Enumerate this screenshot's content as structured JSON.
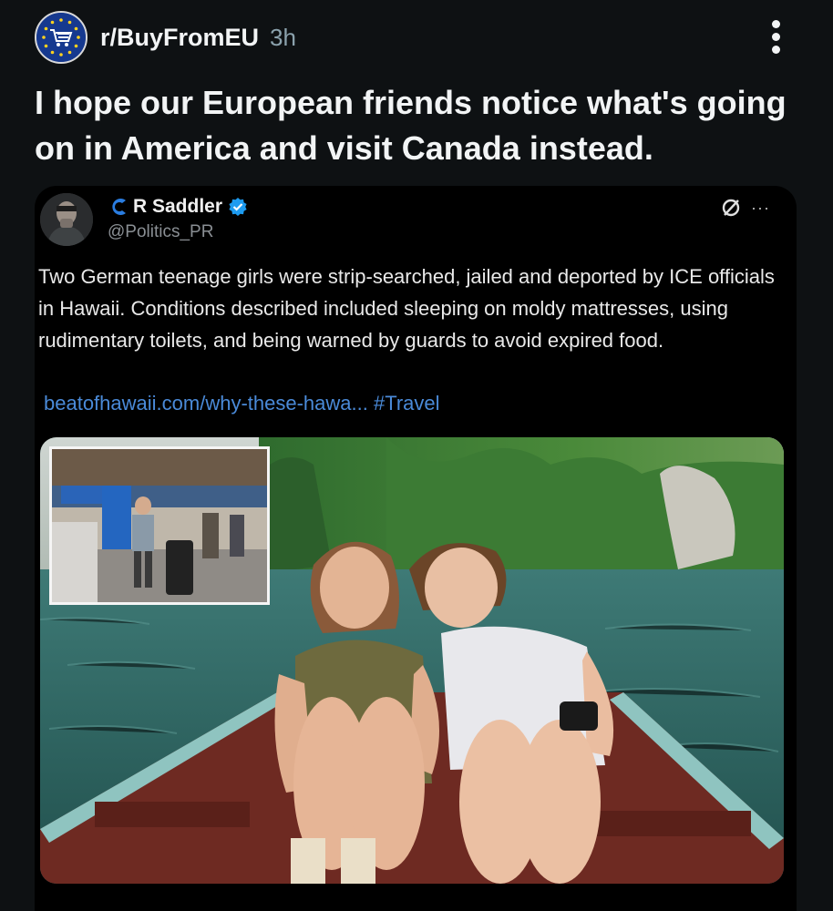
{
  "post": {
    "subreddit": "r/BuyFromEU",
    "age": "3h",
    "title": "I hope our European friends notice what's going on in America and visit Canada instead."
  },
  "tweet": {
    "name": "R Saddler",
    "handle": "@Politics_PR",
    "more": "···",
    "text": "Two German teenage girls were strip-searched, jailed and deported by ICE officials in Hawaii. Conditions described included sleeping on moldy mattresses, using rudimentary toilets, and being warned by guards to avoid expired food.",
    "link": "beatofhawaii.com/why-these-hawa...",
    "hashtag": "#Travel"
  },
  "icons": {
    "subreddit_avatar": "eu-shopping-cart-icon",
    "more": "vertical-dots-icon",
    "verified": "verified-badge-icon",
    "brand": "c-logo-icon",
    "share": "slash-circle-icon"
  },
  "colors": {
    "background": "#0e1113",
    "text": "#f2f4f5",
    "muted": "#8ba2ad",
    "link": "#4a8ad8",
    "verified": "#1d9bf0",
    "brand": "#2a7de1"
  }
}
